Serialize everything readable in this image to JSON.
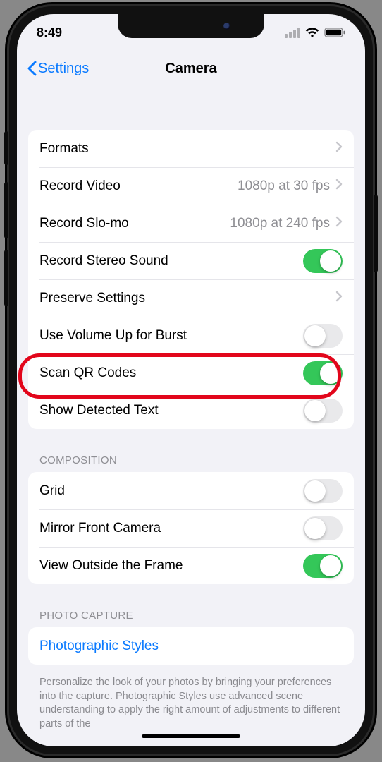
{
  "status": {
    "time": "8:49"
  },
  "nav": {
    "back": "Settings",
    "title": "Camera"
  },
  "group1": [
    {
      "label": "Formats",
      "type": "chevron"
    },
    {
      "label": "Record Video",
      "value": "1080p at 30 fps",
      "type": "chevron"
    },
    {
      "label": "Record Slo-mo",
      "value": "1080p at 240 fps",
      "type": "chevron"
    },
    {
      "label": "Record Stereo Sound",
      "type": "toggle",
      "on": true
    },
    {
      "label": "Preserve Settings",
      "type": "chevron"
    },
    {
      "label": "Use Volume Up for Burst",
      "type": "toggle",
      "on": false
    },
    {
      "label": "Scan QR Codes",
      "type": "toggle",
      "on": true
    },
    {
      "label": "Show Detected Text",
      "type": "toggle",
      "on": false,
      "highlight": true
    }
  ],
  "sections": {
    "composition": "COMPOSITION",
    "photo_capture": "PHOTO CAPTURE"
  },
  "group2": [
    {
      "label": "Grid",
      "type": "toggle",
      "on": false
    },
    {
      "label": "Mirror Front Camera",
      "type": "toggle",
      "on": false
    },
    {
      "label": "View Outside the Frame",
      "type": "toggle",
      "on": true
    }
  ],
  "group3": [
    {
      "label": "Photographic Styles",
      "type": "link"
    }
  ],
  "footer": "Personalize the look of your photos by bringing your preferences into the capture. Photographic Styles use advanced scene understanding to apply the right amount of adjustments to different parts of the"
}
